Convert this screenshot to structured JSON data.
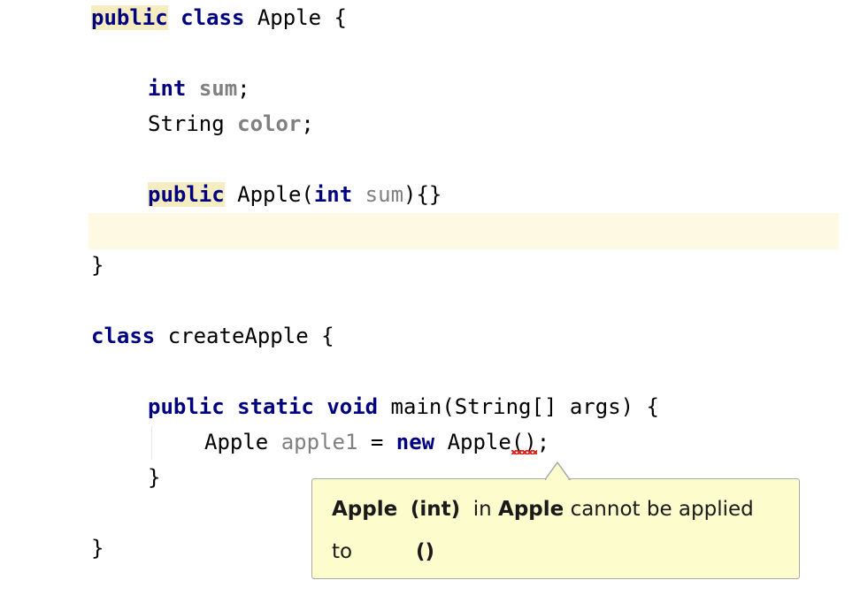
{
  "code": {
    "l1": {
      "kw1": "public",
      "kw2": "class",
      "rest": " Apple {"
    },
    "l3": {
      "kw": "int",
      "field": "sum",
      "end": ";"
    },
    "l4": {
      "type": "String ",
      "field": "color",
      "end": ";"
    },
    "l6": {
      "kw1": "public",
      "rest1": " Apple(",
      "kw2": "int",
      "param": "sum",
      "rest2": "){}"
    },
    "l8": {
      "text": "}"
    },
    "l10": {
      "kw": "class",
      "rest": " createApple {"
    },
    "l12": {
      "kw1": "public",
      "kw2": "static",
      "kw3": "void",
      "rest": " main(String[] args) {"
    },
    "l13": {
      "type": "Apple ",
      "var": "apple1",
      "op": " = ",
      "kw": "new",
      "rest": " Apple",
      "err": "()",
      "end": ";"
    },
    "l14": {
      "text": "}"
    },
    "l16": {
      "text": "}"
    }
  },
  "tooltip": {
    "part1": "Apple",
    "part2": "(int)",
    "part3": "in",
    "part4": "Apple",
    "part5": "cannot be applied",
    "part6": "to",
    "part7": "()"
  }
}
